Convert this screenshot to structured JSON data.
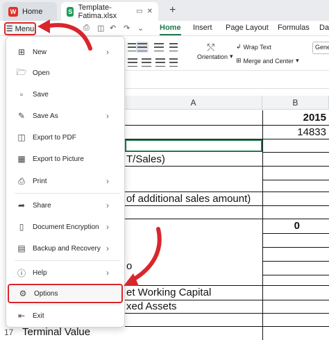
{
  "tabs": {
    "home_label": "Home",
    "home_logo": "W",
    "file_label": "Template-Fatima.xlsx",
    "file_logo": "S",
    "new_tab": "+"
  },
  "menubar": {
    "menu_label": "Menu",
    "ribbon_tabs": [
      "Home",
      "Insert",
      "Page Layout",
      "Formulas",
      "Da"
    ]
  },
  "ribbon": {
    "wrap_text": "Wrap Text",
    "orientation": "Orientation",
    "merge_center": "Merge and Center",
    "general": "Gene"
  },
  "sheet": {
    "col_a": "A",
    "col_b": "B",
    "texts": {
      "t_sales": "T/Sales)",
      "additional": "of additional sales amount)",
      "o": "o",
      "working_capital": "et Working Capital",
      "fixed_assets": "xed Assets",
      "terminal_value": "Terminal Value"
    },
    "numbers": {
      "year": "2015",
      "value": "14833",
      "zero": "0"
    },
    "row_17": "17"
  },
  "menu": {
    "items": [
      {
        "label": "New",
        "icon": "new-file-icon",
        "has_arrow": true
      },
      {
        "label": "Open",
        "icon": "folder-icon",
        "has_arrow": false
      },
      {
        "label": "Save",
        "icon": "save-icon",
        "has_arrow": false
      },
      {
        "label": "Save As",
        "icon": "save-as-icon",
        "has_arrow": true
      },
      {
        "label": "Export to PDF",
        "icon": "pdf-icon",
        "has_arrow": false
      },
      {
        "label": "Export to Picture",
        "icon": "picture-icon",
        "has_arrow": false
      },
      {
        "label": "Print",
        "icon": "print-icon",
        "has_arrow": true
      },
      {
        "label": "Share",
        "icon": "share-icon",
        "has_arrow": true
      },
      {
        "label": "Document Encryption",
        "icon": "encryption-icon",
        "has_arrow": true
      },
      {
        "label": "Backup and Recovery",
        "icon": "backup-icon",
        "has_arrow": true
      },
      {
        "label": "Help",
        "icon": "help-icon",
        "has_arrow": true
      },
      {
        "label": "Options",
        "icon": "options-icon",
        "has_arrow": false
      },
      {
        "label": "Exit",
        "icon": "exit-icon",
        "has_arrow": false
      }
    ]
  },
  "colors": {
    "highlight": "#d9262c",
    "accent_green": "#1c7a4a"
  }
}
